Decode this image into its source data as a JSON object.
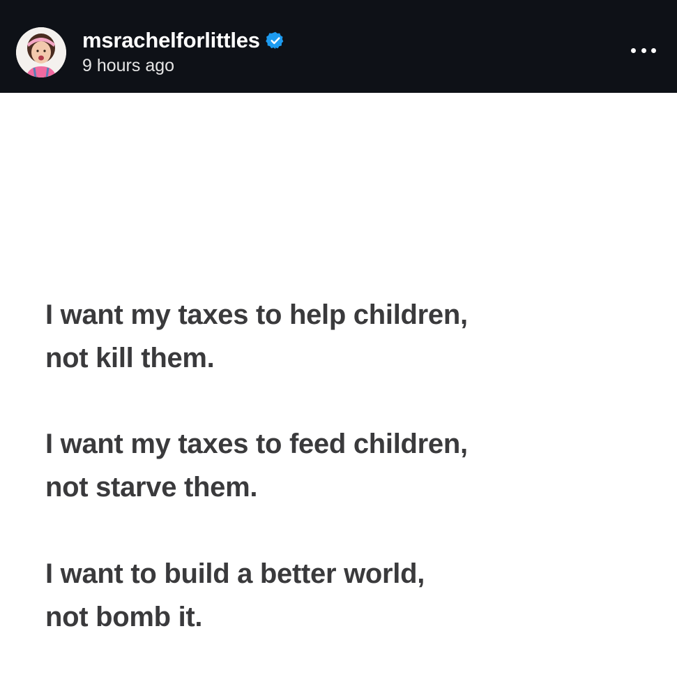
{
  "post": {
    "author": {
      "username": "msrachelforlittles",
      "verified": true,
      "avatar_icon": "avatar-photo",
      "verified_icon": "verified-badge-icon",
      "verified_color": "#1d9bf0"
    },
    "timestamp": "9 hours ago",
    "more_icon": "more-options-icon",
    "stanzas": [
      {
        "line1": "I want my taxes to help children,",
        "line2": "not kill them."
      },
      {
        "line1": "I want my taxes to feed children,",
        "line2": "not starve them."
      },
      {
        "line1": "I want to build a better world,",
        "line2": "not bomb it."
      }
    ]
  },
  "colors": {
    "header_bg": "#0e1117",
    "text": "#3a3a3c",
    "background": "#ffffff"
  }
}
